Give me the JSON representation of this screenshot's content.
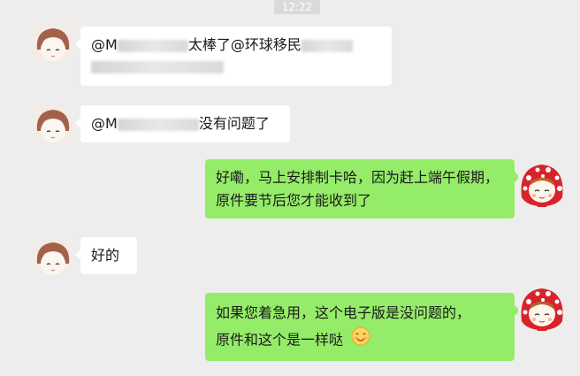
{
  "time": "12:22",
  "messages": [
    {
      "side": "in",
      "line1_prefix": "@M",
      "line1_text": "太棒了@环球移民",
      "line2_text": "",
      "avatar": "girl-brown-hair-avatar"
    },
    {
      "side": "in",
      "line1_prefix": "@M",
      "line1_text": "没有问题了",
      "avatar": "girl-brown-hair-avatar"
    },
    {
      "side": "out",
      "text": "好嘞，马上安排制卡哈，因为赶上端午假期，原件要节后您才能收到了",
      "avatar": "red-hood-avatar"
    },
    {
      "side": "in",
      "text": "好的",
      "avatar": "girl-brown-hair-avatar"
    },
    {
      "side": "out",
      "line1": "如果您着急用，这个电子版是没问题的，",
      "line2": "原件和这个是一样哒",
      "emoji": "smile-emoji",
      "avatar": "red-hood-avatar"
    }
  ],
  "colors": {
    "background": "#ededed",
    "incoming_bubble": "#ffffff",
    "outgoing_bubble": "#95ec69",
    "timestamp_bg": "#dadada"
  }
}
